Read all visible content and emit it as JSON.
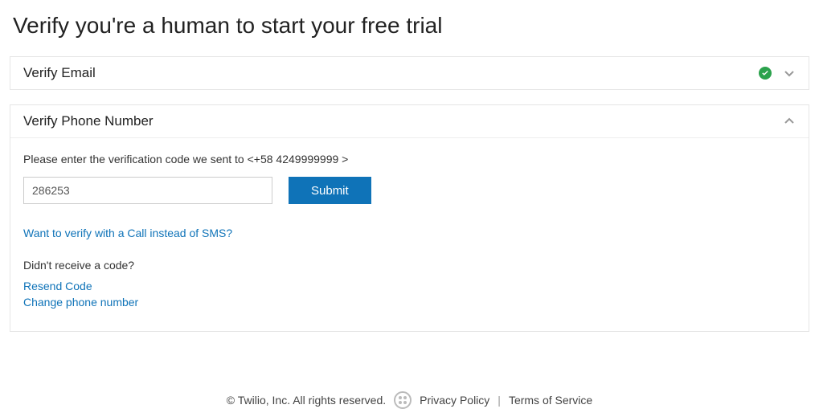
{
  "page": {
    "title": "Verify you're a human to start your free trial"
  },
  "panel1": {
    "title": "Verify Email",
    "completed": true
  },
  "panel2": {
    "title": "Verify Phone Number",
    "instruction_prefix": "Please enter the verification code we sent to <",
    "phone": "+58 4249999999",
    "instruction_suffix": " >",
    "code_value": "286253",
    "submit": "Submit",
    "call_link": "Want to verify with a Call instead of SMS?",
    "no_code": "Didn't receive a code?",
    "resend": "Resend Code",
    "change": "Change phone number"
  },
  "footer": {
    "copyright": "© Twilio, Inc. All rights reserved.",
    "privacy": "Privacy Policy",
    "terms": "Terms of Service"
  }
}
